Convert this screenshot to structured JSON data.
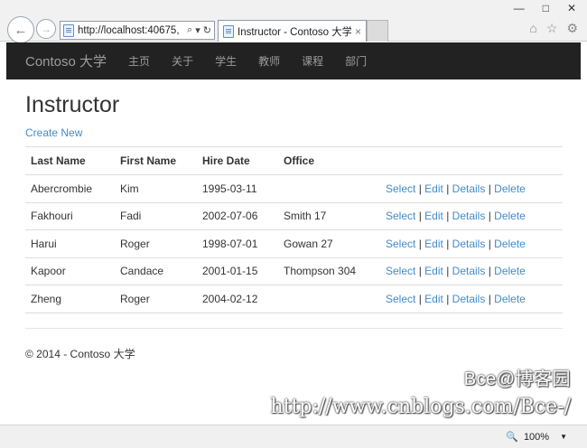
{
  "browser": {
    "url": "http://localhost:40675,",
    "tab_title": "Instructor - Contoso 大学",
    "tab_close": "×",
    "back": "←",
    "forward": "→",
    "minimize": "—",
    "maximize": "□",
    "close": "✕",
    "search_glyph": "⌕",
    "dropdown_glyph": "▾",
    "refresh_glyph": "↻",
    "home_glyph": "⌂",
    "favorites_glyph": "☆",
    "settings_glyph": "⚙"
  },
  "navbar": {
    "brand": "Contoso 大学",
    "items": [
      "主页",
      "关于",
      "学生",
      "教师",
      "课程",
      "部门"
    ]
  },
  "page": {
    "title": "Instructor",
    "create_new": "Create New",
    "columns": [
      "Last Name",
      "First Name",
      "Hire Date",
      "Office"
    ],
    "rows": [
      {
        "last": "Abercrombie",
        "first": "Kim",
        "hire": "1995-03-11",
        "office": ""
      },
      {
        "last": "Fakhouri",
        "first": "Fadi",
        "hire": "2002-07-06",
        "office": "Smith 17"
      },
      {
        "last": "Harui",
        "first": "Roger",
        "hire": "1998-07-01",
        "office": "Gowan 27"
      },
      {
        "last": "Kapoor",
        "first": "Candace",
        "hire": "2001-01-15",
        "office": "Thompson 304"
      },
      {
        "last": "Zheng",
        "first": "Roger",
        "hire": "2004-02-12",
        "office": ""
      }
    ],
    "actions": {
      "select": "Select",
      "edit": "Edit",
      "details": "Details",
      "delete": "Delete",
      "separator": "|"
    },
    "footer": "© 2014 - Contoso 大学"
  },
  "watermark": {
    "line1": "Bce@博客园",
    "line2": "http://www.cnblogs.com/Bce-/"
  },
  "statusbar": {
    "zoom": "100%",
    "zoom_icon": "🔍",
    "zoom_arrow": "▼"
  },
  "colors": {
    "navbar_bg": "#222222",
    "link": "#428bca"
  }
}
